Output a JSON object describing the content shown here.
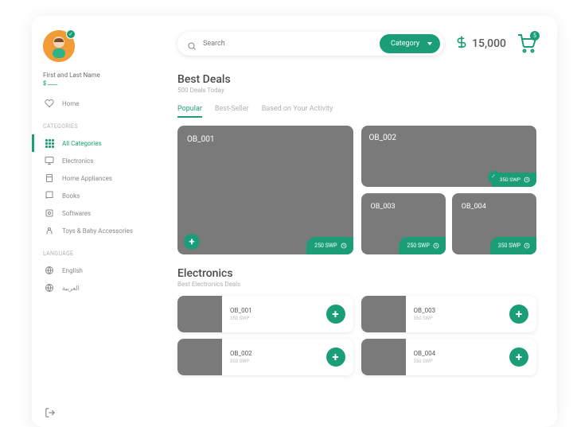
{
  "user": {
    "name": "First and Last Name",
    "sub": "ــــــ"
  },
  "sidebar": {
    "home": "Home",
    "categories_title": "CATEGORIES",
    "language_title": "LANGUAGE",
    "items": [
      "All Categories",
      "Electronics",
      "Home Appliances",
      "Books",
      "Softwares",
      "Toys & Baby Accessories"
    ],
    "langs": [
      "English",
      "العربية"
    ]
  },
  "search": {
    "placeholder": "Search",
    "category": "Category"
  },
  "balance": "15,000",
  "cart_count": "5",
  "deals": {
    "title": "Best Deals",
    "sub": "500 Deals Today",
    "tabs": [
      "Popular",
      "Best-Seller",
      "Based on Your Activity"
    ],
    "cards": [
      {
        "title": "OB_001",
        "price": "250 SWP"
      },
      {
        "title": "OB_002",
        "price": "350 SWP"
      },
      {
        "title": "OB_003",
        "price": "250 SWP"
      },
      {
        "title": "OB_004",
        "price": "350 SWP"
      }
    ]
  },
  "electronics": {
    "title": "Electronics",
    "sub": "Best Electronics Deals",
    "items": [
      {
        "name": "OB_001",
        "price": "350 SWP"
      },
      {
        "name": "OB_002",
        "price": "350 SWP"
      },
      {
        "name": "OB_003",
        "price": "350 SWP"
      },
      {
        "name": "OB_004",
        "price": "350 SWP"
      }
    ]
  }
}
